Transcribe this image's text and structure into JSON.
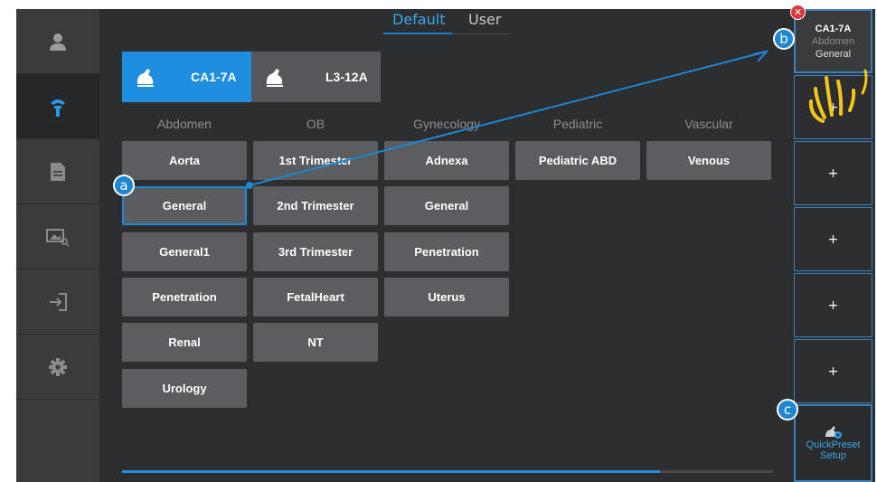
{
  "tabs": [
    {
      "label": "Default",
      "active": true
    },
    {
      "label": "User",
      "active": false
    }
  ],
  "sidebar": {
    "items": [
      {
        "icon": "user-icon"
      },
      {
        "icon": "probe-icon",
        "active": true
      },
      {
        "icon": "report-icon"
      },
      {
        "icon": "review-icon"
      },
      {
        "icon": "exit-icon"
      },
      {
        "icon": "gear-icon"
      }
    ]
  },
  "probes": [
    {
      "label": "CA1-7A",
      "active": true,
      "icon": "probe-icon"
    },
    {
      "label": "L3-12A",
      "active": false,
      "icon": "probe-icon"
    }
  ],
  "categories": [
    {
      "label": "Abdomen",
      "presets": [
        "Aorta",
        "General",
        "General1",
        "Penetration",
        "Renal",
        "Urology"
      ]
    },
    {
      "label": "OB",
      "presets": [
        "1st Trimester",
        "2nd Trimester",
        "3rd Trimester",
        "FetalHeart",
        "NT"
      ]
    },
    {
      "label": "Gynecology",
      "presets": [
        "Adnexa",
        "General",
        "Penetration",
        "Uterus"
      ]
    },
    {
      "label": "Pediatric",
      "presets": [
        "Pediatric ABD"
      ]
    },
    {
      "label": "Vascular",
      "presets": [
        "Venous"
      ]
    }
  ],
  "selected_preset": {
    "category": "Abdomen",
    "label": "General"
  },
  "quick_preset": {
    "slot1": {
      "probe": "CA1-7A",
      "category": "Abdomen",
      "preset": "General"
    },
    "empty_slot_label": "+",
    "empty_slot_count": 5,
    "setup_label_line1": "QuickPreset",
    "setup_label_line2": "Setup",
    "setup_icon": "probe-gear-icon"
  },
  "callouts": {
    "a": "a",
    "b": "b",
    "c": "c"
  },
  "delete_badge": "✕",
  "colors": {
    "accent": "#1f8ee0",
    "background": "#2d2e30",
    "sidebar": "#3a3b3d",
    "button": "#5b5d60",
    "highlight_border": "#1e8ad6",
    "callout": "#1f86d4",
    "gesture": "#f5c518",
    "delete": "#d9363e"
  },
  "scroll": {
    "progress": 0.83
  }
}
